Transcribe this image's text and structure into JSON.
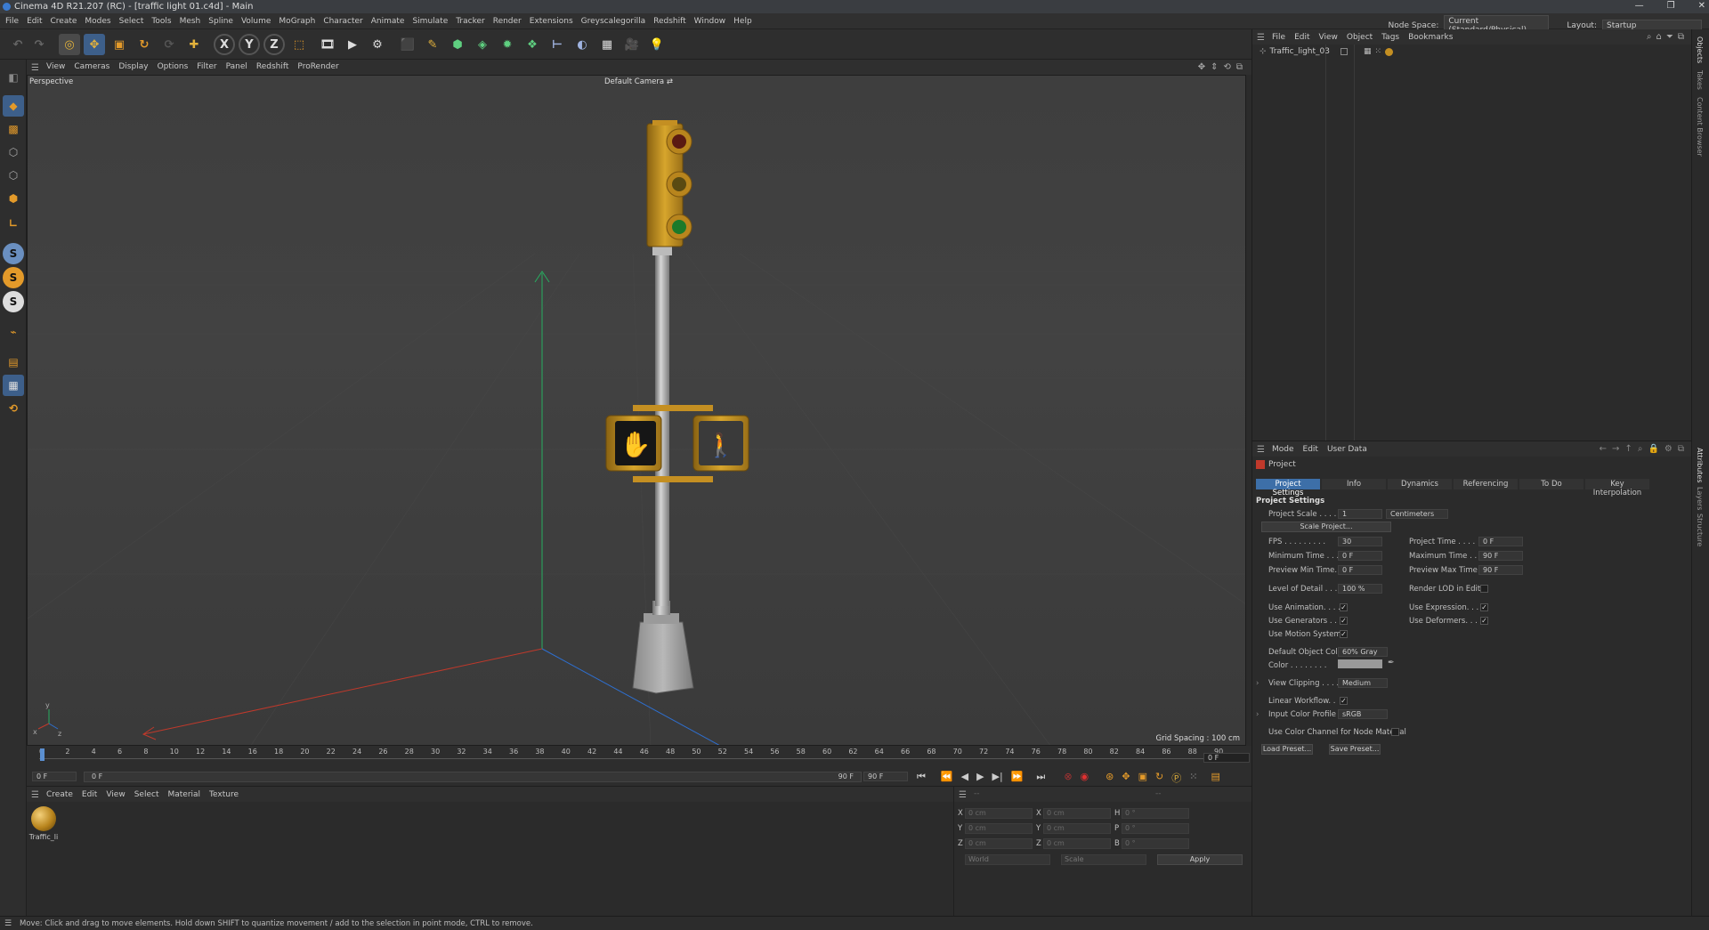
{
  "title_bar": {
    "title": "Cinema 4D R21.207 (RC) - [traffic light 01.c4d] - Main",
    "controls": [
      "—",
      "❐",
      "✕"
    ]
  },
  "menubar": {
    "items": [
      "File",
      "Edit",
      "Create",
      "Modes",
      "Select",
      "Tools",
      "Mesh",
      "Spline",
      "Volume",
      "MoGraph",
      "Character",
      "Animate",
      "Simulate",
      "Tracker",
      "Render",
      "Extensions",
      "Greyscalegorilla",
      "Redshift",
      "Window",
      "Help"
    ],
    "node_space_label": "Node Space:",
    "node_space_value": "Current (Standard/Physical)",
    "layout_label": "Layout:",
    "layout_value": "Startup"
  },
  "viewport": {
    "menu": [
      "View",
      "Cameras",
      "Display",
      "Options",
      "Filter",
      "Panel",
      "Redshift",
      "ProRender"
    ],
    "projection": "Perspective",
    "camera": "Default Camera",
    "grid_spacing": "Grid Spacing : 100 cm"
  },
  "timeline": {
    "ticks": [
      "0",
      "2",
      "4",
      "6",
      "8",
      "10",
      "12",
      "14",
      "16",
      "18",
      "20",
      "22",
      "24",
      "26",
      "28",
      "30",
      "32",
      "34",
      "36",
      "38",
      "40",
      "42",
      "44",
      "46",
      "48",
      "50",
      "52",
      "54",
      "56",
      "58",
      "60",
      "62",
      "64",
      "66",
      "68",
      "70",
      "72",
      "74",
      "76",
      "78",
      "80",
      "82",
      "84",
      "86",
      "88",
      "90"
    ],
    "current_frame": "0 F",
    "start_field": "0 F",
    "start_field2": "0 F",
    "end_label": "90 F",
    "end_field": "90 F"
  },
  "material_manager": {
    "menu": [
      "Create",
      "Edit",
      "View",
      "Select",
      "Material",
      "Texture"
    ],
    "materials": [
      {
        "name": "Traffic_li"
      }
    ]
  },
  "coord_manager": {
    "rows": [
      {
        "a": "X",
        "av": "0 cm",
        "b": "X",
        "bv": "0 cm",
        "c": "H",
        "cv": "0 °"
      },
      {
        "a": "Y",
        "av": "0 cm",
        "b": "Y",
        "bv": "0 cm",
        "c": "P",
        "cv": "0 °"
      },
      {
        "a": "Z",
        "av": "0 cm",
        "b": "Z",
        "bv": "0 cm",
        "c": "B",
        "cv": "0 °"
      }
    ],
    "dash1": "--",
    "dash2": "--",
    "mode1": "World",
    "mode2": "Scale",
    "apply": "Apply"
  },
  "status_bar": {
    "text": "Move: Click and drag to move elements. Hold down SHIFT to quantize movement / add to the selection in point mode, CTRL to remove."
  },
  "object_manager": {
    "menu": [
      "File",
      "Edit",
      "View",
      "Object",
      "Tags",
      "Bookmarks"
    ],
    "objects": [
      {
        "name": "Traffic_light_03"
      }
    ]
  },
  "attribute_manager": {
    "menu": [
      "Mode",
      "Edit",
      "User Data"
    ],
    "object": "Project",
    "tabs": [
      "Project Settings",
      "Info",
      "Dynamics",
      "Referencing",
      "To Do",
      "Key Interpolation"
    ],
    "section": "Project Settings",
    "project_scale_label": "Project Scale . . . .",
    "project_scale_value": "1",
    "project_scale_unit": "Centimeters",
    "scale_project_btn": "Scale Project...",
    "fps_label": "FPS . . . . . . . . .",
    "fps_value": "30",
    "project_time_label": "Project Time . . . .",
    "project_time_value": "0 F",
    "min_time_label": "Minimum Time . . .",
    "min_time_value": "0 F",
    "max_time_label": "Maximum Time . .",
    "max_time_value": "90 F",
    "preview_min_label": "Preview Min Time. .",
    "preview_min_value": "0 F",
    "preview_max_label": "Preview Max Time",
    "preview_max_value": "90 F",
    "lod_label": "Level of Detail . . .",
    "lod_value": "100 %",
    "render_lod_label": "Render LOD in Editor",
    "use_animation_label": "Use Animation. . . .",
    "use_expression_label": "Use Expression. . .",
    "use_generators_label": "Use Generators . . .",
    "use_deformers_label": "Use Deformers. . .",
    "use_motion_label": "Use Motion System",
    "default_color_label": "Default Object Color",
    "default_color_value": "60% Gray",
    "color_label": "Color . . . . . . . .",
    "view_clipping_label": "View Clipping . . . .",
    "view_clipping_value": "Medium",
    "linear_workflow_label": "Linear Workflow. .",
    "input_color_label": "Input Color Profile .",
    "input_color_value": "sRGB",
    "color_channel_label": "Use Color Channel for Node Material",
    "load_preset": "Load Preset...",
    "save_preset": "Save Preset...",
    "check": "✓",
    "expand": "›"
  },
  "side_tabs": [
    "Objects",
    "Takes",
    "Content Browser",
    "Attributes",
    "Layers",
    "Structure"
  ],
  "colors": {
    "accent": "#3d6fa8",
    "signal_yellow": "#c9951f",
    "x_axis": "#c0392b",
    "y_axis": "#27ae60",
    "z_axis": "#2e6fd0"
  }
}
